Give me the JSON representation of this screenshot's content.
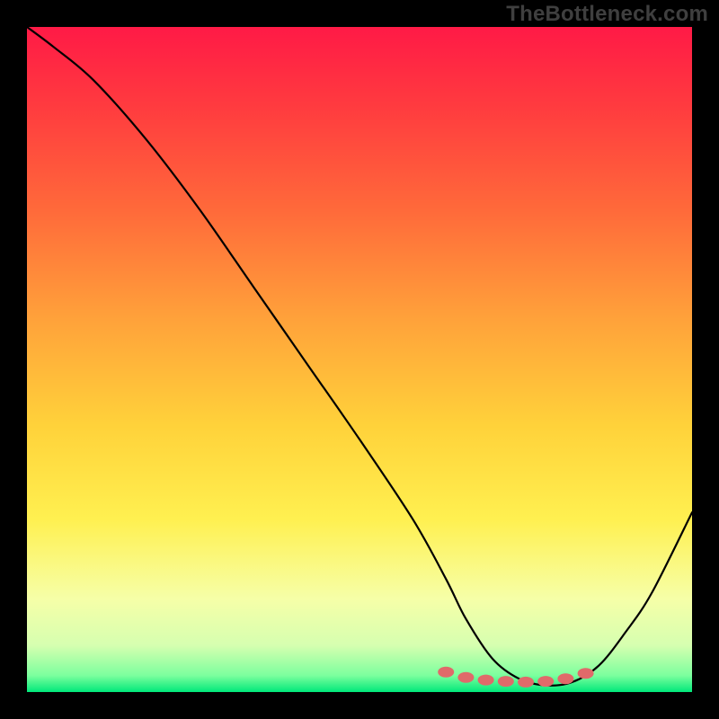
{
  "watermark": "TheBottleneck.com",
  "chart_data": {
    "type": "line",
    "title": "",
    "xlabel": "",
    "ylabel": "",
    "xlim": [
      0,
      100
    ],
    "ylim": [
      0,
      100
    ],
    "grid": false,
    "series": [
      {
        "name": "bottleneck-curve",
        "x": [
          0,
          4,
          10,
          18,
          26,
          34,
          42,
          50,
          58,
          63,
          66,
          70,
          74,
          78,
          82,
          86,
          90,
          94,
          100
        ],
        "y": [
          100,
          97,
          92,
          83,
          72.5,
          61,
          49.5,
          38,
          26,
          17,
          11,
          5,
          2,
          1,
          1.5,
          4,
          9,
          15,
          27
        ]
      },
      {
        "name": "optimum-markers",
        "type": "scatter",
        "x": [
          63,
          66,
          69,
          72,
          75,
          78,
          81,
          84
        ],
        "y": [
          3,
          2.2,
          1.8,
          1.6,
          1.5,
          1.6,
          2.0,
          2.8
        ]
      }
    ],
    "gradient_stops": [
      {
        "offset": 0.0,
        "color": "#ff1a46"
      },
      {
        "offset": 0.12,
        "color": "#ff3b3f"
      },
      {
        "offset": 0.28,
        "color": "#ff6b3a"
      },
      {
        "offset": 0.44,
        "color": "#ffa23a"
      },
      {
        "offset": 0.6,
        "color": "#ffd23a"
      },
      {
        "offset": 0.74,
        "color": "#fff050"
      },
      {
        "offset": 0.86,
        "color": "#f6ffa8"
      },
      {
        "offset": 0.93,
        "color": "#d6ffb0"
      },
      {
        "offset": 0.975,
        "color": "#7cff9e"
      },
      {
        "offset": 1.0,
        "color": "#00e87a"
      }
    ],
    "marker_color": "#e06a6a",
    "curve_color": "#000000"
  }
}
